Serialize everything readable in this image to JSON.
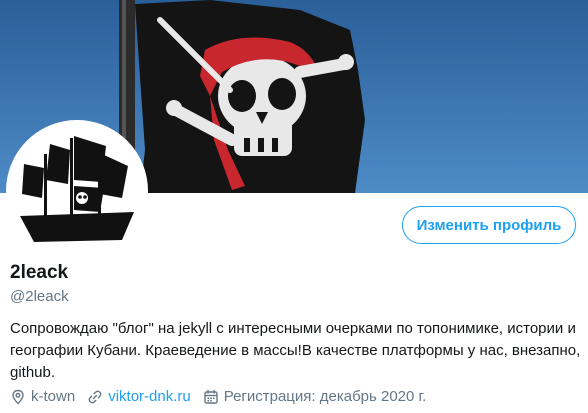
{
  "profile": {
    "name": "2leack",
    "handle": "@2leack",
    "bio": "Сопровождаю \"блог\" на jekyll с интересными очерками по топонимике, истории и географии Кубани. Краеведение в массы!В качестве платформы у нас, внезапно, github.",
    "edit_button_label": "Изменить профиль"
  },
  "meta": {
    "location": "k-town",
    "website": "viktor-dnk.ru",
    "joined": "Регистрация: декабрь 2020 г."
  },
  "icons": {
    "location": "location-pin-icon",
    "link": "link-icon",
    "calendar": "calendar-icon"
  },
  "colors": {
    "accent": "#1da1f2",
    "muted_text": "#657786",
    "primary_text": "#14171a",
    "sky": "#3a6fa8",
    "flag": "#141414",
    "bandana": "#c8272d"
  }
}
